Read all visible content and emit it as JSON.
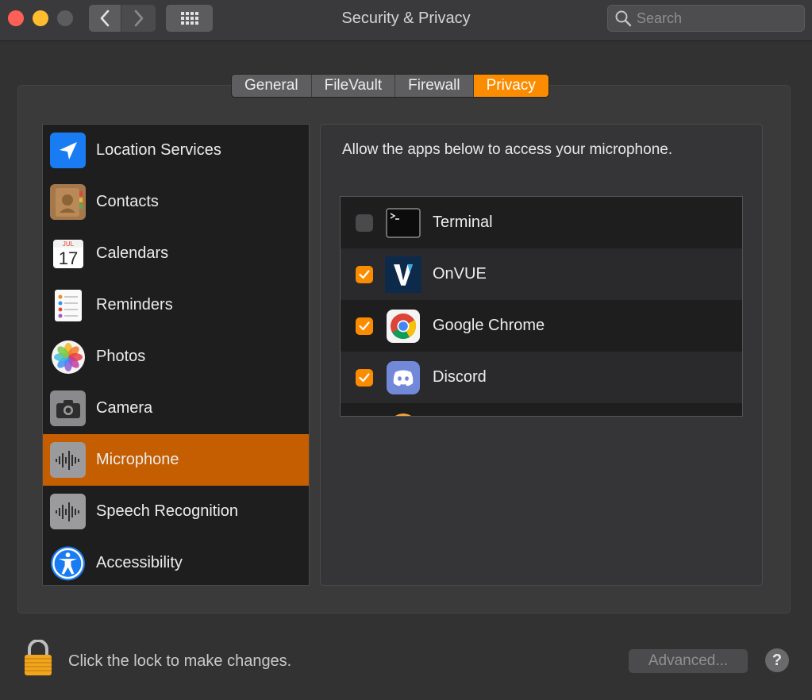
{
  "window": {
    "title": "Security & Privacy"
  },
  "search": {
    "placeholder": "Search"
  },
  "tabs": [
    {
      "label": "General",
      "active": false
    },
    {
      "label": "FileVault",
      "active": false
    },
    {
      "label": "Firewall",
      "active": false
    },
    {
      "label": "Privacy",
      "active": true
    }
  ],
  "sidebar": {
    "items": [
      {
        "label": "Location Services",
        "icon": "location-arrow-icon"
      },
      {
        "label": "Contacts",
        "icon": "contacts-book-icon"
      },
      {
        "label": "Calendars",
        "icon": "calendar-icon",
        "calendar_month": "JUL",
        "calendar_day": "17"
      },
      {
        "label": "Reminders",
        "icon": "reminders-list-icon"
      },
      {
        "label": "Photos",
        "icon": "photos-flower-icon"
      },
      {
        "label": "Camera",
        "icon": "camera-icon"
      },
      {
        "label": "Microphone",
        "icon": "microphone-waveform-icon",
        "selected": true
      },
      {
        "label": "Speech Recognition",
        "icon": "speech-waveform-icon"
      },
      {
        "label": "Accessibility",
        "icon": "accessibility-person-icon"
      }
    ]
  },
  "detail": {
    "description": "Allow the apps below to access your microphone.",
    "apps": [
      {
        "name": "Terminal",
        "checked": false,
        "icon": "terminal-icon"
      },
      {
        "name": "OnVUE",
        "checked": true,
        "icon": "onvue-logo-icon"
      },
      {
        "name": "Google Chrome",
        "checked": true,
        "icon": "chrome-logo-icon"
      },
      {
        "name": "Discord",
        "checked": true,
        "icon": "discord-logo-icon"
      }
    ]
  },
  "footer": {
    "lock_text": "Click the lock to make changes.",
    "advanced_label": "Advanced...",
    "help_label": "?"
  },
  "colors": {
    "accent": "#fb8c00",
    "selection": "#c45e00",
    "background": "#323232"
  }
}
